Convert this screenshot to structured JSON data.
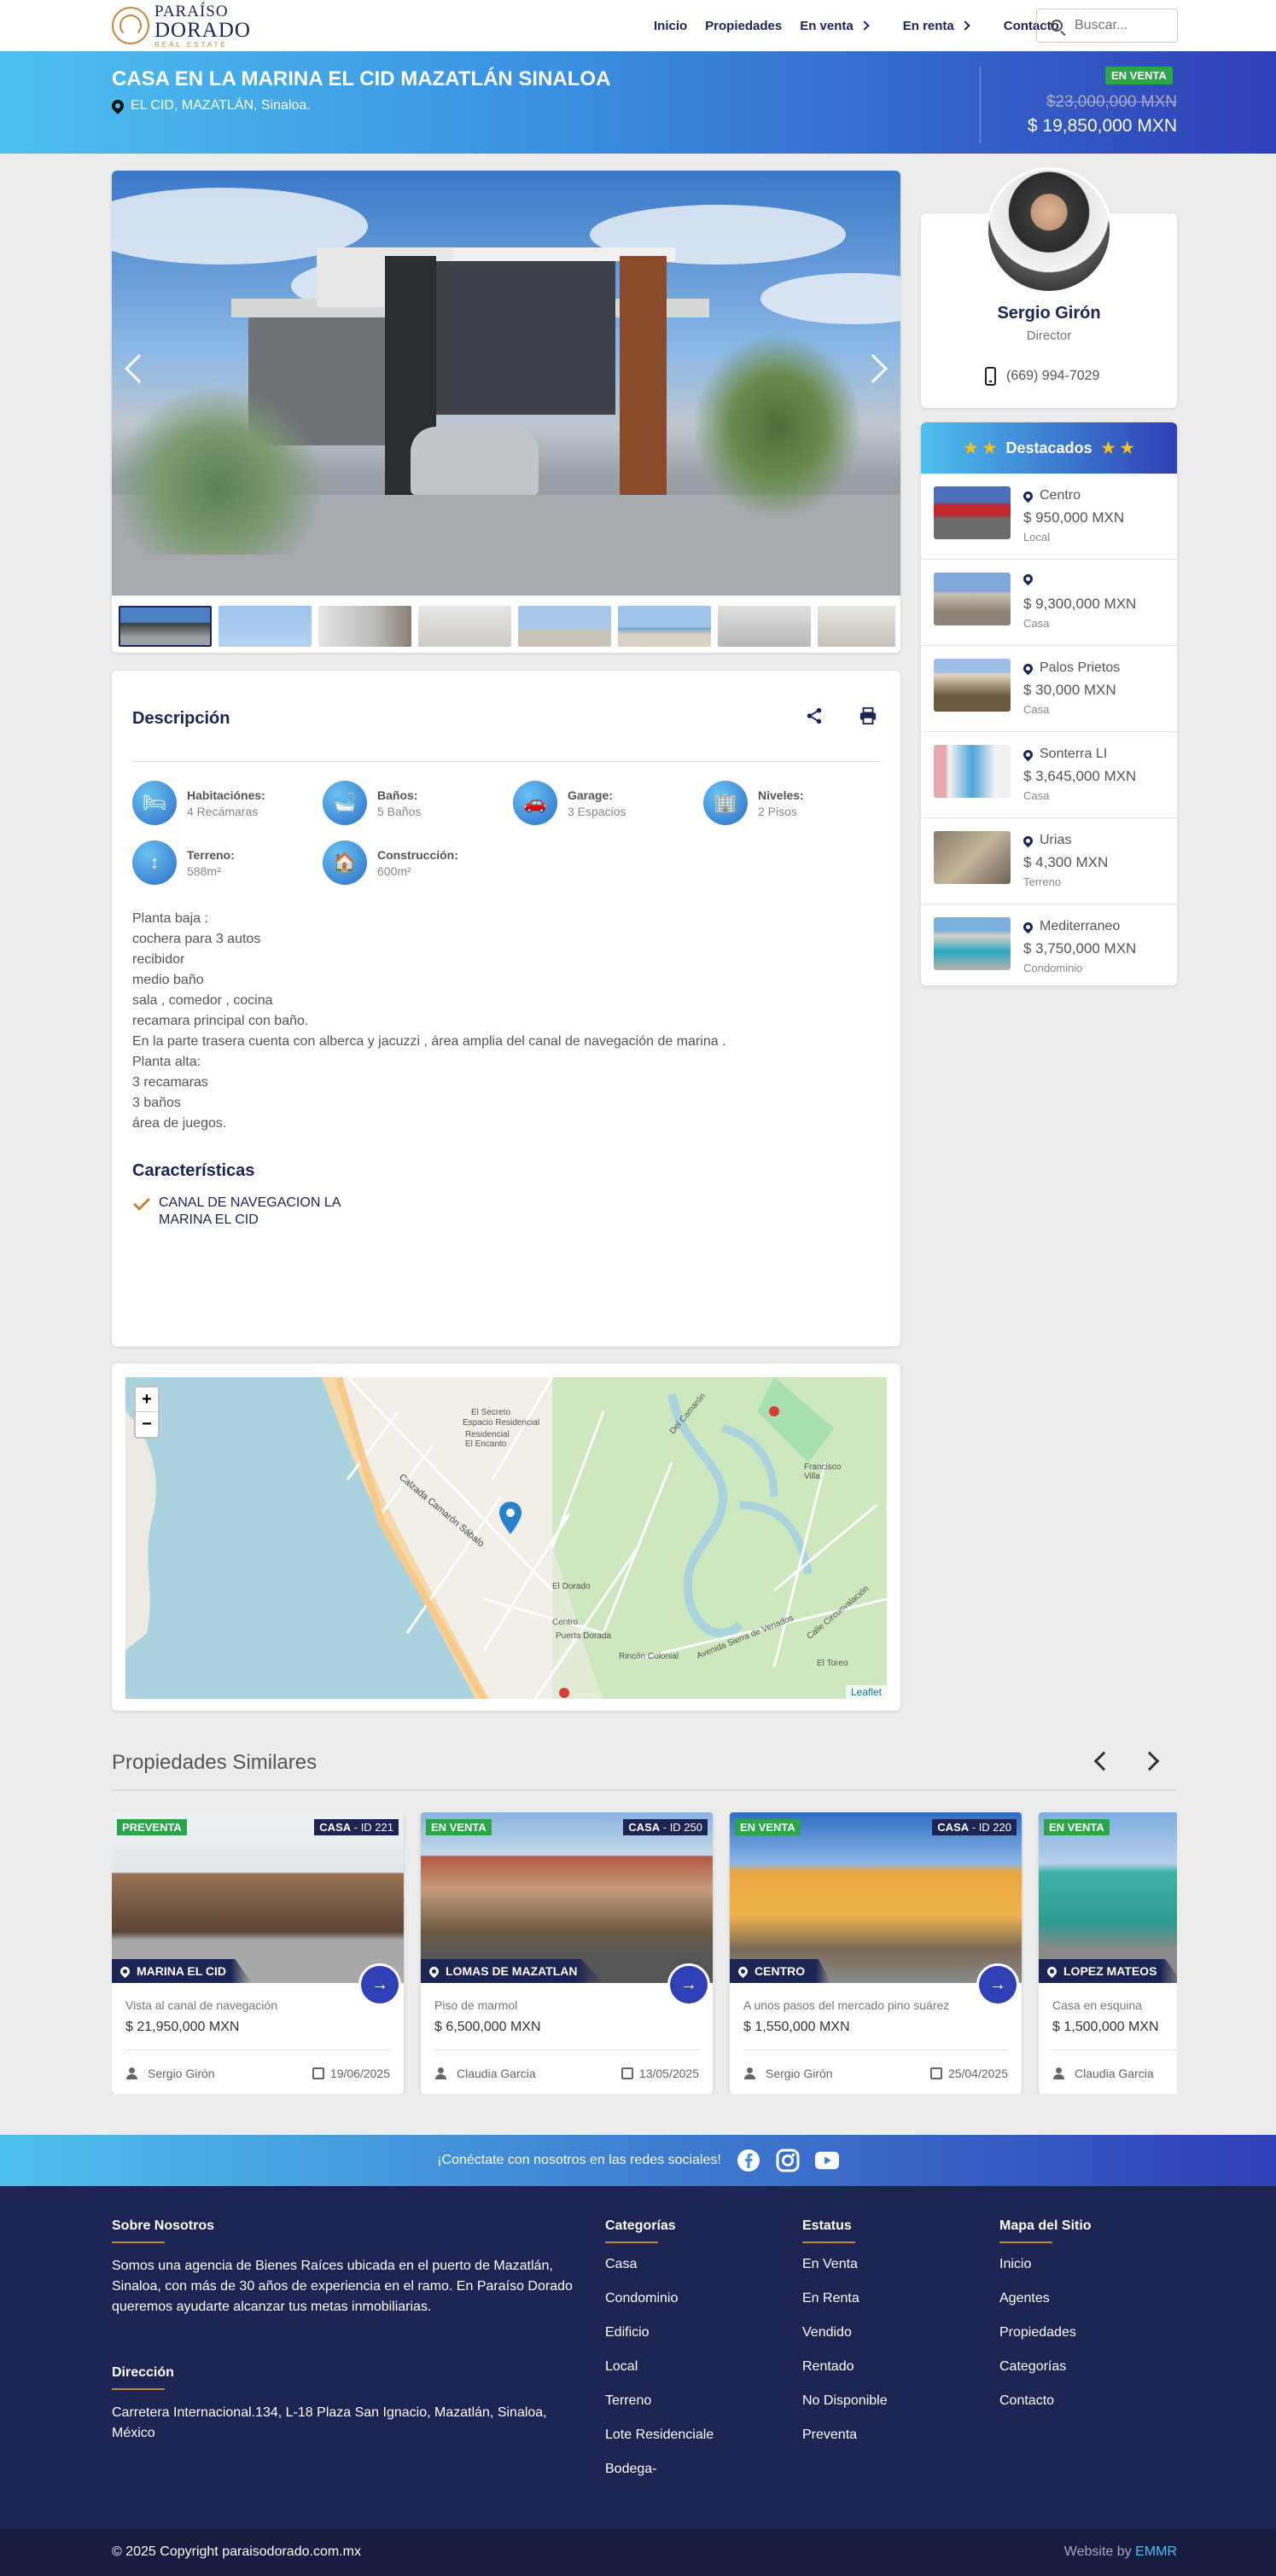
{
  "nav": {
    "logo_line1": "PARAÍSO",
    "logo_line2": "DORADO",
    "logo_line3": "REAL ESTATE",
    "items": [
      {
        "label": "Inicio"
      },
      {
        "label": "Propiedades"
      },
      {
        "label": "En venta"
      },
      {
        "label": "En renta"
      },
      {
        "label": "Contacto"
      }
    ],
    "search_placeholder": "Buscar..."
  },
  "hero": {
    "title": "CASA EN LA MARINA EL CID MAZATLÁN SINALOA",
    "location": "EL CID, MAZATLÁN, Sinaloa.",
    "status": "EN VENTA",
    "old_price": "$23,000,000 MXN",
    "price": "$ 19,850,000 MXN"
  },
  "agent": {
    "name": "Sergio Girón",
    "role": "Director",
    "phone": "(669) 994-7029"
  },
  "featured": {
    "title": "Destacados",
    "items": [
      {
        "location": "Centro",
        "price": "$ 950,000 MXN",
        "type": "Local"
      },
      {
        "location": "",
        "price": "$ 9,300,000 MXN",
        "type": "Casa"
      },
      {
        "location": "Palos Prietos",
        "price": "$ 30,000 MXN",
        "type": "Casa"
      },
      {
        "location": "Sonterra LI",
        "price": "$ 3,645,000 MXN",
        "type": "Casa"
      },
      {
        "location": "Urias",
        "price": "$ 4,300 MXN",
        "type": "Terreno"
      },
      {
        "location": "Mediterraneo",
        "price": "$ 3,750,000 MXN",
        "type": "Condominio"
      }
    ]
  },
  "description": {
    "title": "Descripción",
    "features": [
      {
        "label": "Habitaciónes:",
        "value": "4 Recámaras"
      },
      {
        "label": "Baños:",
        "value": "5 Baños"
      },
      {
        "label": "Garage:",
        "value": "3 Espacios"
      },
      {
        "label": "Niveles:",
        "value": "2 Pisos"
      },
      {
        "label": "Terreno:",
        "value": "588m²"
      },
      {
        "label": "Construcción:",
        "value": "600m²"
      }
    ],
    "body": [
      "Planta baja :",
      "cochera para 3 autos",
      "recibidor",
      "medio baño",
      "sala , comedor , cocina",
      "recamara principal con baño.",
      "En la parte trasera cuenta con alberca y jacuzzi , área amplia del canal de navegación de marina .",
      "Planta alta:",
      "3 recamaras",
      "3 baños",
      "área de juegos."
    ],
    "characteristics_title": "Características",
    "characteristics": [
      "CANAL DE NAVEGACION LA MARINA EL CID"
    ]
  },
  "map": {
    "zoom_in": "+",
    "zoom_out": "−",
    "attribution": "Leaflet",
    "labels": [
      "El Secreto",
      "Espacio Residencial",
      "Residencial El Encanto",
      "Calzada Camarón Sábalo",
      "El Dorado",
      "Puerta Dorada",
      "Rincón Colonial",
      "Francisco Villa",
      "El Toreo",
      "Avenida Sierra de Venados",
      "Calle Circunvalación",
      "Del Camarón",
      "Centro"
    ]
  },
  "similar": {
    "title": "Propiedades Similares",
    "cards": [
      {
        "status": "PREVENTA",
        "type": "CASA",
        "id": " - ID 221",
        "location": "MARINA EL CID",
        "desc": "Vista al canal de navegación",
        "price": "$ 21,950,000 MXN",
        "agent": "Sergio Girón",
        "date": "19/06/2025"
      },
      {
        "status": "EN VENTA",
        "type": "CASA",
        "id": " - ID 250",
        "location": "LOMAS DE MAZATLAN",
        "desc": "Piso de marmol",
        "price": "$ 6,500,000 MXN",
        "agent": "Claudia Garcia",
        "date": "13/05/2025"
      },
      {
        "status": "EN VENTA",
        "type": "CASA",
        "id": " - ID 220",
        "location": "CENTRO",
        "desc": "A unos pasos del mercado pino suárez",
        "price": "$ 1,550,000 MXN",
        "agent": "Sergio Girón",
        "date": "25/04/2025"
      },
      {
        "status": "EN VENTA",
        "type": "",
        "id": "",
        "location": "LOPEZ MATEOS",
        "desc": "Casa en esquina",
        "price": "$ 1,500,000 MXN",
        "agent": "Claudia Garcia",
        "date": ""
      }
    ]
  },
  "social": {
    "text": "¡Conéctate con nosotros en las redes sociales!"
  },
  "footer": {
    "about_title": "Sobre Nosotros",
    "about_text": "Somos una agencia de Bienes Raíces ubicada en el puerto de Mazatlán, Sinaloa, con más de 30 años de experiencia en el ramo. En Paraíso Dorado queremos ayudarte alcanzar tus metas inmobiliarias.",
    "address_title": "Dirección",
    "address_text": "Carretera Internacional.134, L-18 Plaza San Ignacio, Mazatlán, Sinaloa, México",
    "categories_title": "Categorías",
    "categories": [
      "Casa",
      "Condominio",
      "Edificio",
      "Local",
      "Terreno",
      "Lote Residenciale",
      "Bodega-"
    ],
    "status_title": "Estatus",
    "status": [
      "En Venta",
      "En Renta",
      "Vendido",
      "Rentado",
      "No Disponible",
      "Preventa"
    ],
    "sitemap_title": "Mapa del Sitio",
    "sitemap": [
      "Inicio",
      "Agentes",
      "Propiedades",
      "Categorías",
      "Contacto"
    ],
    "copyright": "© 2025 Copyright paraisodorado.com.mx",
    "credit_prefix": "Website by",
    "credit_name": "EMMR"
  },
  "colors": {
    "navy": "#1c2453",
    "gold": "#c1873b",
    "green": "#2ca44a",
    "accent": "#2f3fb6",
    "sky": "#4ec0ee"
  }
}
